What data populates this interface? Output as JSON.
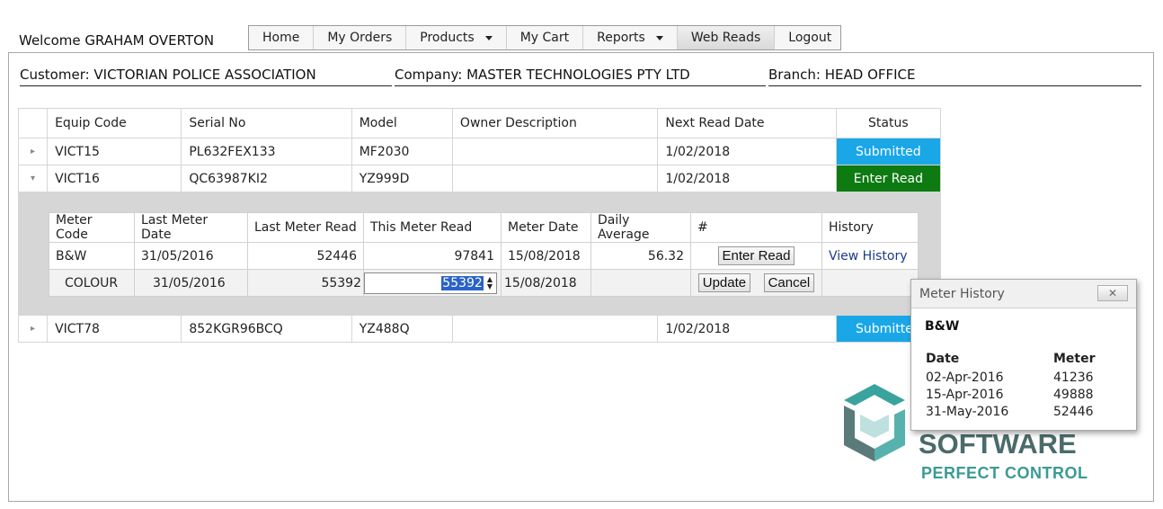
{
  "welcome": "Welcome GRAHAM OVERTON",
  "nav": {
    "items": [
      {
        "label": "Home"
      },
      {
        "label": "My Orders"
      },
      {
        "label": "Products"
      },
      {
        "label": "My Cart"
      },
      {
        "label": "Reports"
      },
      {
        "label": "Web Reads"
      },
      {
        "label": "Logout"
      }
    ]
  },
  "customer": {
    "customer": "Customer: VICTORIAN POLICE ASSOCIATION",
    "company": "Company: MASTER TECHNOLOGIES PTY LTD",
    "branch": "Branch: HEAD OFFICE"
  },
  "equipment": {
    "headers": [
      "Equip Code",
      "Serial No",
      "Model",
      "Owner Description",
      "Next Read Date",
      "Status"
    ],
    "rows": [
      {
        "code": "VICT15",
        "serial": "PL632FEX133",
        "model": "MF2030",
        "owner": "",
        "next": "1/02/2018",
        "status": "Submitted"
      },
      {
        "code": "VICT16",
        "serial": "QC63987KI2",
        "model": "YZ999D",
        "owner": "",
        "next": "1/02/2018",
        "status": "Enter Read"
      },
      {
        "code": "VICT78",
        "serial": "852KGR96BCQ",
        "model": "YZ488Q",
        "owner": "",
        "next": "1/02/2018",
        "status": "Submitted"
      }
    ]
  },
  "meters": {
    "headers": [
      "Meter Code",
      "Last Meter Date",
      "Last Meter Read",
      "This Meter Read",
      "Meter Date",
      "Daily Average",
      "#",
      "History"
    ],
    "rows": [
      {
        "code": "B&W",
        "last_date": "31/05/2016",
        "last_read": "52446",
        "this_read": "97841",
        "meter_date": "15/08/2018",
        "daily_avg": "56.32",
        "action": "Enter Read",
        "history": "View History"
      },
      {
        "code": "COLOUR",
        "last_date": "31/05/2016",
        "last_read": "55392",
        "this_read": "55392",
        "meter_date": "15/08/2018",
        "daily_avg": "",
        "update": "Update",
        "cancel": "Cancel",
        "history": ""
      }
    ]
  },
  "popup": {
    "title": "Meter History",
    "close": "✕",
    "meter": "B&W",
    "col_date": "Date",
    "col_meter": "Meter",
    "rows": [
      {
        "date": "02-Apr-2016",
        "meter": "41236"
      },
      {
        "date": "15-Apr-2016",
        "meter": "49888"
      },
      {
        "date": "31-May-2016",
        "meter": "52446"
      }
    ]
  },
  "logo": {
    "line1": "SOFTWARE",
    "line2": "PERFECT CONTROL"
  },
  "colors": {
    "submitted": "#1aa7e8",
    "enter_read": "#0e7a12",
    "logo_dark": "#4b6b6b",
    "logo_accent": "#3a9a95"
  }
}
